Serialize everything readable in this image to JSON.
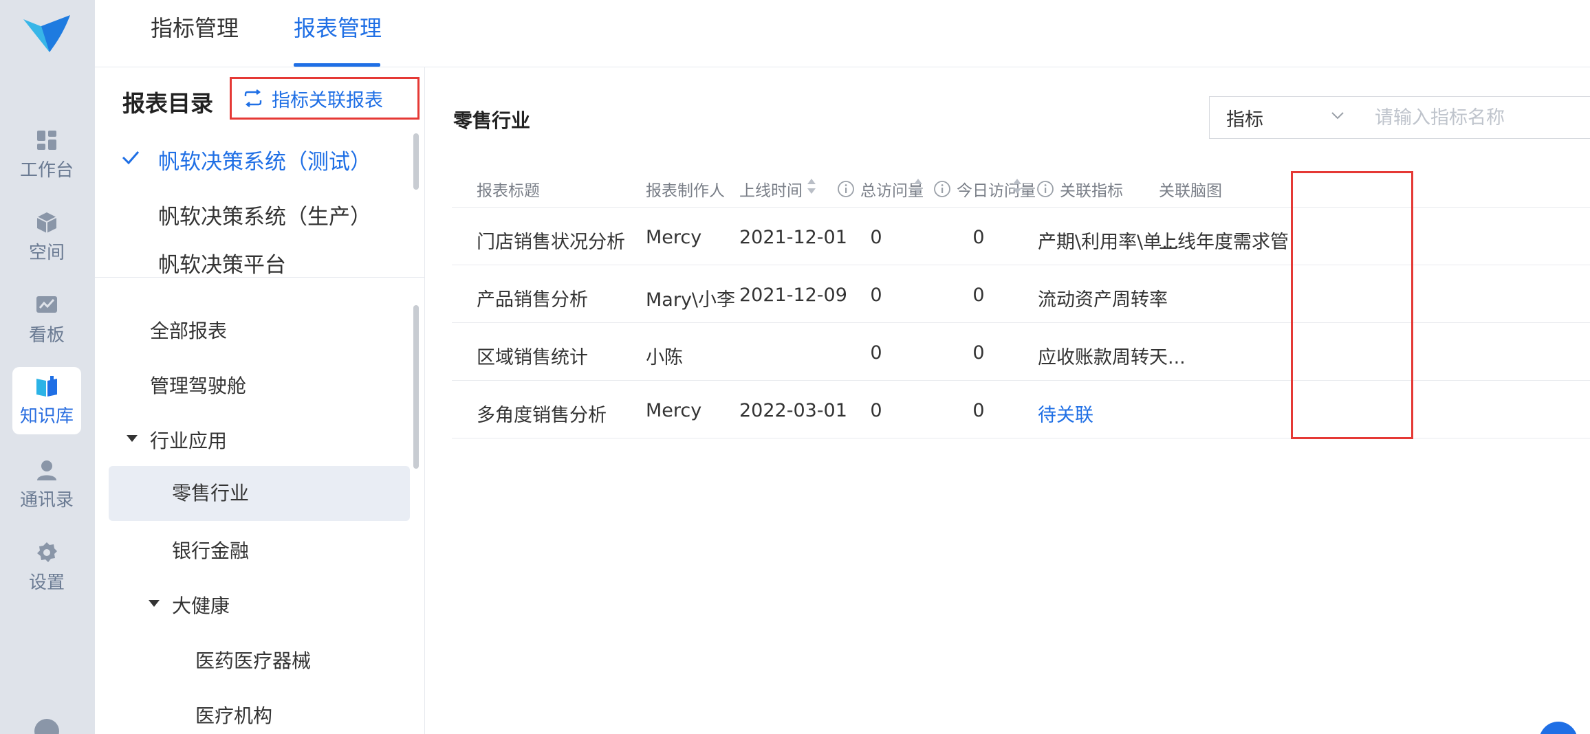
{
  "rail": {
    "items": [
      {
        "label": "工作台"
      },
      {
        "label": "空间"
      },
      {
        "label": "看板"
      },
      {
        "label": "知识库"
      },
      {
        "label": "通讯录"
      },
      {
        "label": "设置"
      }
    ],
    "active_index": 3
  },
  "tabs": [
    {
      "label": "指标管理"
    },
    {
      "label": "报表管理"
    }
  ],
  "active_tab": 1,
  "catalog": {
    "title": "报表目录",
    "link_button_label": "指标关联报表",
    "systems": [
      {
        "label": "帆软决策系统（测试）",
        "selected": true
      },
      {
        "label": "帆软决策系统（生产）"
      },
      {
        "label": "帆软决策平台"
      }
    ],
    "tree": [
      {
        "label": "全部报表"
      },
      {
        "label": "管理驾驶舱"
      },
      {
        "label": "行业应用",
        "expanded": true
      },
      {
        "label": "零售行业",
        "selected": true
      },
      {
        "label": "银行金融"
      },
      {
        "label": "大健康",
        "expanded": true
      },
      {
        "label": "医药医疗器械"
      },
      {
        "label": "医疗机构"
      }
    ]
  },
  "main": {
    "section_title": "零售行业",
    "filter": {
      "selected": "指标",
      "placeholder": "请输入指标名称"
    },
    "columns": [
      "报表标题",
      "报表制作人",
      "上线时间",
      "总访问量",
      "今日访问量",
      "关联指标",
      "关联脑图"
    ],
    "rows": [
      {
        "title": "门店销售状况分析",
        "author": "Mercy",
        "date": "2021-12-01",
        "total": "0",
        "today": "0",
        "metric": "产期\\利用率\\单...",
        "mindmap": "上线年度需求管"
      },
      {
        "title": "产品销售分析",
        "author": "Mary\\小李",
        "date": "2021-12-09",
        "total": "0",
        "today": "0",
        "metric": "流动资产周转率",
        "mindmap": ""
      },
      {
        "title": "区域销售统计",
        "author": "小陈",
        "date": "",
        "total": "0",
        "today": "0",
        "metric": "应收账款周转天...",
        "mindmap": ""
      },
      {
        "title": "多角度销售分析",
        "author": "Mercy",
        "date": "2022-03-01",
        "total": "0",
        "today": "0",
        "metric": "待关联",
        "mindmap": ""
      }
    ]
  },
  "colors": {
    "accent": "#1f6fe5",
    "highlight_border": "#e53935",
    "rail_bg": "#dfe3ea"
  }
}
